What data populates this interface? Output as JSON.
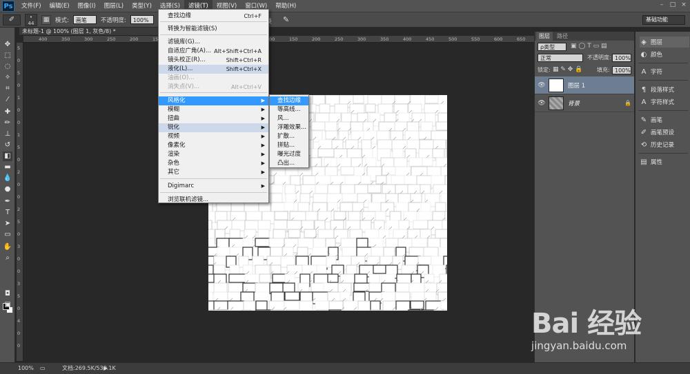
{
  "app": {
    "logo": "Ps"
  },
  "menubar": {
    "items": [
      "文件(F)",
      "编辑(E)",
      "图像(I)",
      "图层(L)",
      "类型(Y)",
      "选择(S)",
      "滤镜(T)",
      "视图(V)",
      "窗口(W)",
      "帮助(H)"
    ],
    "active_index": 6
  },
  "options": {
    "brush_size": "44",
    "mode_label": "模式:",
    "mode_value": "画笔",
    "opacity_label": "不透明度:",
    "opacity_value": "100%",
    "suffix_label": "录",
    "workspace": "基础功能"
  },
  "document": {
    "tab_title": "未标题-1 @ 100% (图层 1, 灰色/8) *",
    "ruler_h": [
      "400",
      "350",
      "300",
      "250",
      "200",
      "150",
      "100",
      "50",
      "0",
      "50",
      "100",
      "150",
      "200",
      "250",
      "300",
      "350",
      "400",
      "450",
      "500",
      "550",
      "600",
      "650",
      "700"
    ],
    "ruler_v": [
      "5",
      "0",
      "5",
      "0",
      "1",
      "0",
      "0",
      "1",
      "5",
      "0",
      "2",
      "0",
      "0",
      "2",
      "5",
      "0",
      "3",
      "0",
      "0",
      "3",
      "5",
      "0",
      "4",
      "0",
      "0"
    ]
  },
  "status": {
    "zoom": "100%",
    "doc_info": "文档:269.5K/539.1K"
  },
  "filter_menu": {
    "items": [
      {
        "label": "查找边缘",
        "shortcut": "Ctrl+F",
        "state": ""
      },
      {
        "label": "转换为智能滤镜(S)",
        "shortcut": "",
        "state": ""
      },
      {
        "label": "滤镜库(G)...",
        "shortcut": "",
        "state": ""
      },
      {
        "label": "自适应广角(A)...",
        "shortcut": "Alt+Shift+Ctrl+A",
        "state": ""
      },
      {
        "label": "镜头校正(R)...",
        "shortcut": "Shift+Ctrl+R",
        "state": ""
      },
      {
        "label": "液化(L)...",
        "shortcut": "Shift+Ctrl+X",
        "state": "hl"
      },
      {
        "label": "油画(O)...",
        "shortcut": "",
        "state": "dis"
      },
      {
        "label": "消失点(V)...",
        "shortcut": "Alt+Ctrl+V",
        "state": "dis"
      },
      {
        "label": "风格化",
        "shortcut": "",
        "state": "sel",
        "submenu": true
      },
      {
        "label": "模糊",
        "shortcut": "",
        "state": "",
        "submenu": true
      },
      {
        "label": "扭曲",
        "shortcut": "",
        "state": "",
        "submenu": true
      },
      {
        "label": "锐化",
        "shortcut": "",
        "state": "hl",
        "submenu": true
      },
      {
        "label": "视频",
        "shortcut": "",
        "state": "",
        "submenu": true
      },
      {
        "label": "像素化",
        "shortcut": "",
        "state": "",
        "submenu": true
      },
      {
        "label": "渲染",
        "shortcut": "",
        "state": "",
        "submenu": true
      },
      {
        "label": "杂色",
        "shortcut": "",
        "state": "",
        "submenu": true
      },
      {
        "label": "其它",
        "shortcut": "",
        "state": "",
        "submenu": true
      },
      {
        "label": "Digimarc",
        "shortcut": "",
        "state": "",
        "submenu": true
      },
      {
        "label": "浏览联机滤镜...",
        "shortcut": "",
        "state": ""
      }
    ]
  },
  "stylize_submenu": {
    "items": [
      "查找边缘",
      "等高线...",
      "风...",
      "浮雕效果...",
      "扩散...",
      "拼贴...",
      "曝光过度",
      "凸出..."
    ]
  },
  "layers_panel": {
    "tabs": [
      "图层",
      "路径"
    ],
    "kind_filter": "ρ类型",
    "blend_mode": "正常",
    "opacity_label": "不透明度:",
    "opacity_value": "100%",
    "lock_label": "锁定:",
    "fill_label": "填充:",
    "fill_value": "100%",
    "layers": [
      {
        "name": "图层 1",
        "selected": true
      },
      {
        "name": "背景",
        "selected": false
      }
    ]
  },
  "dock": {
    "items": [
      {
        "label": "图层",
        "icon": "layers-icon"
      },
      {
        "label": "颜色",
        "icon": "color-icon"
      },
      {
        "label": "字符",
        "icon": "character-icon"
      },
      {
        "label": "段落样式",
        "icon": "paragraph-styles-icon"
      },
      {
        "label": "字符样式",
        "icon": "character-styles-icon"
      },
      {
        "label": "画笔",
        "icon": "brush-icon"
      },
      {
        "label": "画笔预设",
        "icon": "brush-presets-icon"
      },
      {
        "label": "历史记录",
        "icon": "history-icon"
      },
      {
        "label": "属性",
        "icon": "properties-icon"
      }
    ]
  },
  "watermark": {
    "brand": "Bai 经验",
    "url": "jingyan.baidu.com"
  }
}
